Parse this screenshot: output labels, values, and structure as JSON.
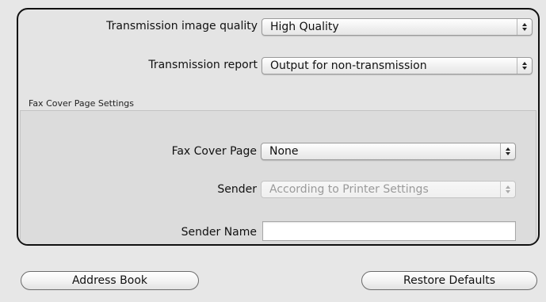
{
  "form": {
    "transmission_quality": {
      "label": "Transmission image quality",
      "value": "High Quality"
    },
    "transmission_report": {
      "label": "Transmission report",
      "value": "Output for non-transmission"
    }
  },
  "cover_section": {
    "title": "Fax Cover Page Settings",
    "cover_page": {
      "label": "Fax Cover Page",
      "value": "None"
    },
    "sender": {
      "label": "Sender",
      "value": "According to Printer Settings",
      "disabled": true
    },
    "sender_name": {
      "label": "Sender Name",
      "value": ""
    }
  },
  "buttons": {
    "address_book": "Address Book",
    "restore_defaults": "Restore Defaults"
  },
  "icons": {
    "popup_arrows": "up-down-chevron-icon"
  }
}
